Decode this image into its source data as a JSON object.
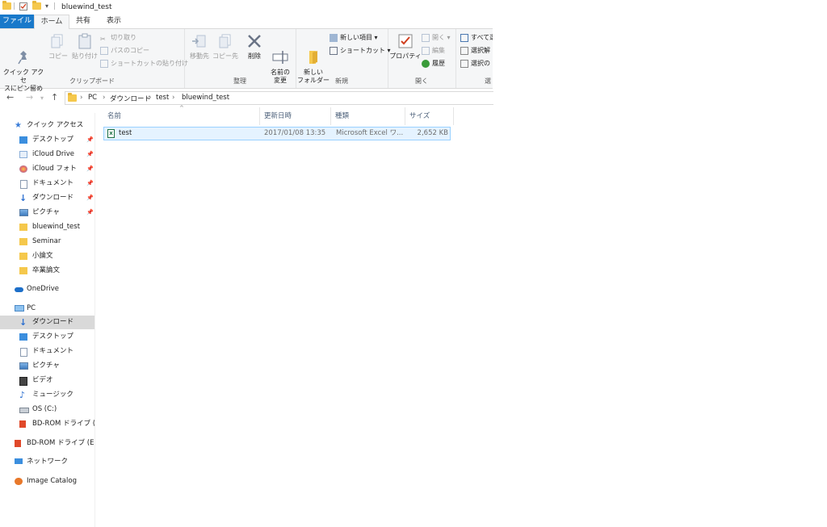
{
  "window": {
    "title": "bluewind_test"
  },
  "ribbon_tabs": [
    "ファイル",
    "ホーム",
    "共有",
    "表示"
  ],
  "ribbon": {
    "clipboard": {
      "group_label": "クリップボード",
      "pin_quick_access": "クイック アクセ\nスにピン留め",
      "copy": "コピー",
      "paste": "貼り付け",
      "cut": "切り取り",
      "copy_path": "パスのコピー",
      "paste_shortcut": "ショートカットの貼り付け"
    },
    "organize": {
      "group_label": "整理",
      "move_to": "移動先",
      "copy_to": "コピー先",
      "delete": "削除",
      "rename": "名前の\n変更"
    },
    "new": {
      "group_label": "新規",
      "new_folder": "新しい\nフォルダー",
      "new_item": "新しい項目",
      "shortcut": "ショートカット"
    },
    "open": {
      "group_label": "開く",
      "properties": "プロパティ",
      "open": "開く",
      "edit": "編集",
      "history": "履歴"
    },
    "select": {
      "group_label": "選",
      "select_all": "すべて選",
      "select_none": "選択解",
      "invert": "選択の"
    }
  },
  "nav_buttons": {
    "back": "←",
    "forward": "→",
    "up": "↑"
  },
  "breadcrumb": [
    "PC",
    "ダウンロード",
    "test",
    "bluewind_test"
  ],
  "columns": {
    "name": "名前",
    "modified": "更新日時",
    "type": "種類",
    "size": "サイズ"
  },
  "files": [
    {
      "name": "test",
      "modified": "2017/01/08 13:35",
      "type": "Microsoft Excel ワ...",
      "size": "2,652 KB"
    }
  ],
  "navigation": {
    "quick_access": "クイック アクセス",
    "quick_items": [
      "デスクトップ",
      "iCloud Drive",
      "iCloud フォト",
      "ドキュメント",
      "ダウンロード",
      "ピクチャ",
      "bluewind_test",
      "Seminar",
      "小論文",
      "卒業論文"
    ],
    "onedrive": "OneDrive",
    "pc": "PC",
    "pc_items": [
      "ダウンロード",
      "デスクトップ",
      "ドキュメント",
      "ピクチャ",
      "ビデオ",
      "ミュージック",
      "OS (C:)",
      "BD-ROM ドライブ (E:)"
    ],
    "bd_rom": "BD-ROM ドライブ (E:) N",
    "network": "ネットワーク",
    "image_catalog": "Image Catalog"
  },
  "colors": {
    "file_tab": "#1979ca",
    "selection": "#e5f3ff",
    "selection_border": "#99d1ff",
    "folder": "#f5c84c"
  }
}
